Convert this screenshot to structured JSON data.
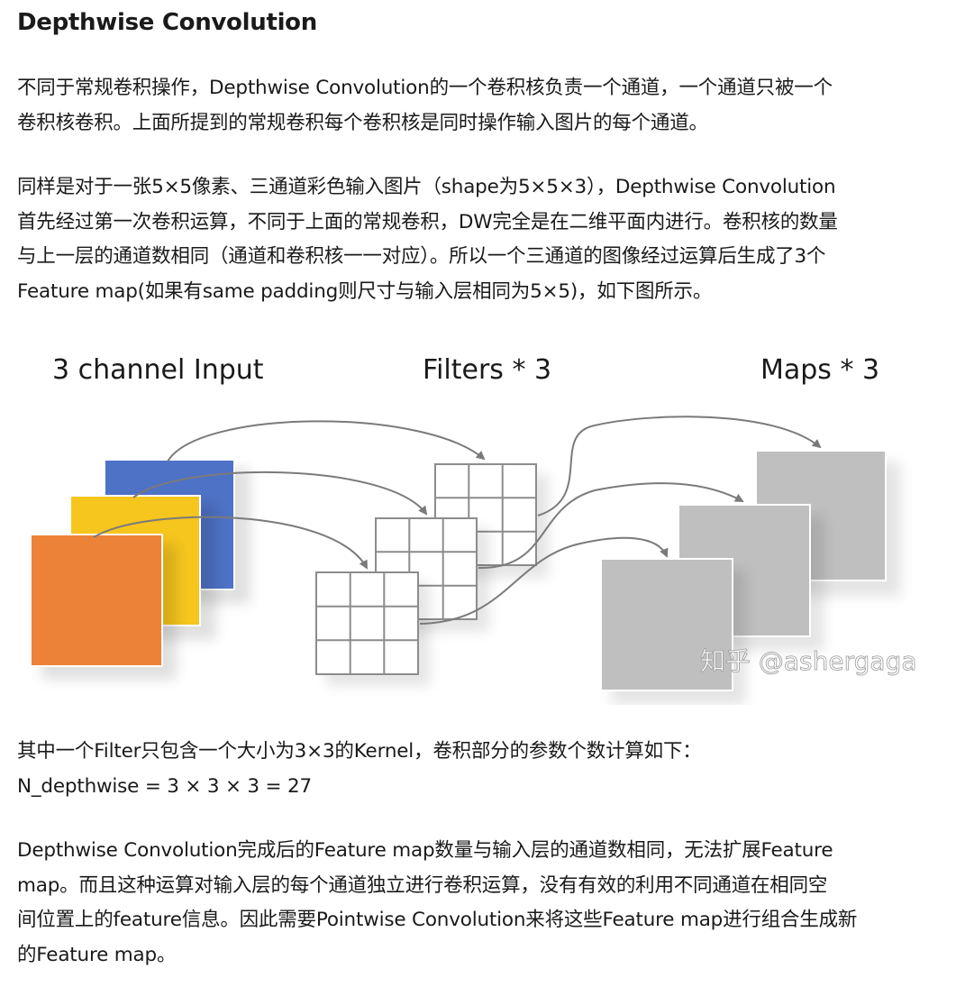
{
  "article": {
    "heading": "Depthwise Convolution",
    "p1": [
      "不同于常规卷积操作，Depthwise Convolution的一个卷积核负责一个通道，一个通道只被一个",
      "卷积核卷积。上面所提到的常规卷积每个卷积核是同时操作输入图片的每个通道。"
    ],
    "p2": [
      "同样是对于一张5×5像素、三通道彩色输入图片（shape为5×5×3），Depthwise Convolution",
      "首先经过第一次卷积运算，不同于上面的常规卷积，DW完全是在二维平面内进行。卷积核的数量",
      "与上一层的通道数相同（通道和卷积核一一对应）。所以一个三通道的图像经过运算后生成了3个",
      "Feature map(如果有same padding则尺寸与输入层相同为5×5)，如下图所示。"
    ],
    "p3": [
      "其中一个Filter只包含一个大小为3×3的Kernel，卷积部分的参数个数计算如下：",
      "N_depthwise = 3 × 3 × 3 = 27"
    ],
    "p4": [
      "Depthwise Convolution完成后的Feature map数量与输入层的通道数相同，无法扩展Feature",
      "map。而且这种运算对输入层的每个通道独立进行卷积运算，没有有效的利用不同通道在相同空",
      "间位置上的feature信息。因此需要Pointwise Convolution来将这些Feature map进行组合生成新",
      "的Feature map。"
    ]
  },
  "figure": {
    "label_input": "3 channel Input",
    "label_filters": "Filters * 3",
    "label_maps": "Maps * 3",
    "watermark": "知乎 @ashergaga",
    "colors": {
      "channel_blue": "#4e72c6",
      "channel_yellow": "#f6c51e",
      "channel_orange": "#ec8237",
      "map_gray": "#bfbfbf",
      "grid_line": "#8c8c8c",
      "arrow": "#7a7a7a"
    }
  }
}
